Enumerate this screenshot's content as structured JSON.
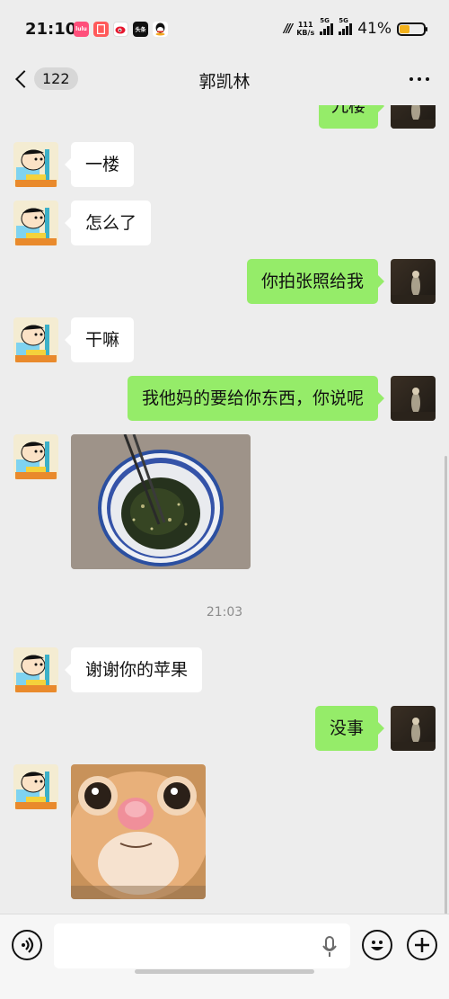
{
  "status_bar": {
    "time": "21:10",
    "app_icons": [
      "lulu-app-icon",
      "notes-app-icon",
      "weibo-icon",
      "news-app-icon",
      "qq-icon"
    ],
    "net_speed_value": "111",
    "net_speed_unit": "KB/s",
    "signal_1_label": "5G",
    "signal_2_label": "5G",
    "battery_percent": "41%",
    "battery_level": 0.41,
    "accent_battery": "#f2b11c"
  },
  "nav": {
    "back_count": "122",
    "title": "郭凯林",
    "more_icon": "more-dots-icon"
  },
  "messages": [
    {
      "side": "out",
      "type": "text",
      "text": "九楼",
      "partial": true
    },
    {
      "side": "in",
      "type": "text",
      "text": "一楼"
    },
    {
      "side": "in",
      "type": "text",
      "text": "怎么了"
    },
    {
      "side": "out",
      "type": "text",
      "text": "你拍张照给我"
    },
    {
      "side": "in",
      "type": "text",
      "text": "干嘛"
    },
    {
      "side": "out",
      "type": "text",
      "text": "我他妈的要给你东西，你说呢"
    },
    {
      "side": "in",
      "type": "image",
      "description_icon": "food-bowl-photo"
    },
    {
      "side": "system",
      "type": "time",
      "text": "21:03"
    },
    {
      "side": "in",
      "type": "text",
      "text": "谢谢你的苹果"
    },
    {
      "side": "out",
      "type": "text",
      "text": "没事"
    },
    {
      "side": "in",
      "type": "image",
      "description_icon": "cat-face-photo"
    }
  ],
  "colors": {
    "background": "#ededed",
    "bubble_out": "#95ec69",
    "bubble_in": "#ffffff",
    "timestamp": "#8c8c8c"
  },
  "input_bar": {
    "placeholder": "",
    "icons": [
      "voice-icon",
      "mic-icon",
      "emoji-icon",
      "plus-icon"
    ]
  }
}
